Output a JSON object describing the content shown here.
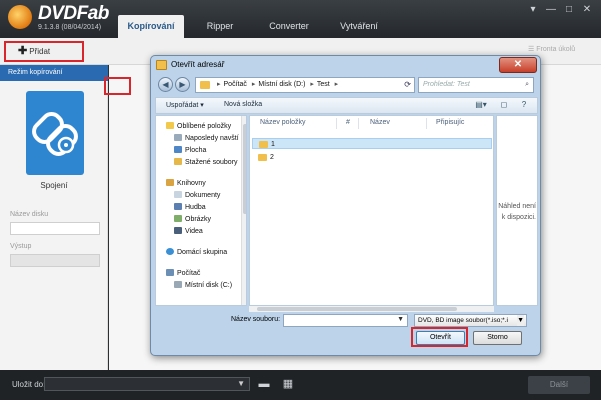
{
  "app": {
    "name": "DVDFab",
    "version": "9.1.3.8 (08/04/2014)",
    "tabs": [
      {
        "label": "Kopírování"
      },
      {
        "label": "Ripper"
      },
      {
        "label": "Converter"
      },
      {
        "label": "Vytváření"
      }
    ],
    "window_controls": [
      "▾",
      "—",
      "□",
      "✕"
    ]
  },
  "toolbar": {
    "add_label": "Přidat",
    "queue_label": "Fronta úkolů"
  },
  "left_panel": {
    "mode_header": "Režim kopírování",
    "mode_tile_label": "Spojení",
    "disc_name_label": "Název disku",
    "disc_name_value": "",
    "output_label": "Výstup",
    "output_value": ""
  },
  "bottom_bar": {
    "save_to_label": "Uložit do:",
    "save_to_value": "",
    "start_label": "Další"
  },
  "dialog": {
    "title": "Otevřít adresář",
    "address": {
      "segments": [
        "Počítač",
        "Místní disk (D:)",
        "Test"
      ]
    },
    "search_placeholder": "Prohledat: Test",
    "commands": {
      "organize": "Uspořádat ▾",
      "new_folder": "Nová složka"
    },
    "nav_groups": [
      {
        "label": "Oblíbené položky",
        "items": [
          "Naposledy navští",
          "Plocha",
          "Stažené soubory"
        ]
      },
      {
        "label": "Knihovny",
        "items": [
          "Dokumenty",
          "Hudba",
          "Obrázky",
          "Videa"
        ]
      },
      {
        "label": "Domácí skupina",
        "items": []
      },
      {
        "label": "Počítač",
        "items": [
          "Místní disk (C:)"
        ]
      }
    ],
    "columns": [
      "Název položky",
      "#",
      "Název",
      "Připisujíc"
    ],
    "files": [
      {
        "name": "1",
        "selected": true
      },
      {
        "name": "2",
        "selected": false
      }
    ],
    "preview_text": [
      "Náhled není",
      "k dispozici."
    ],
    "filename_label": "Název souboru:",
    "filename_value": "",
    "filetype_value": "DVD, BD image soubor(*.iso;*.i",
    "open_label": "Otevřít",
    "cancel_label": "Storno"
  }
}
